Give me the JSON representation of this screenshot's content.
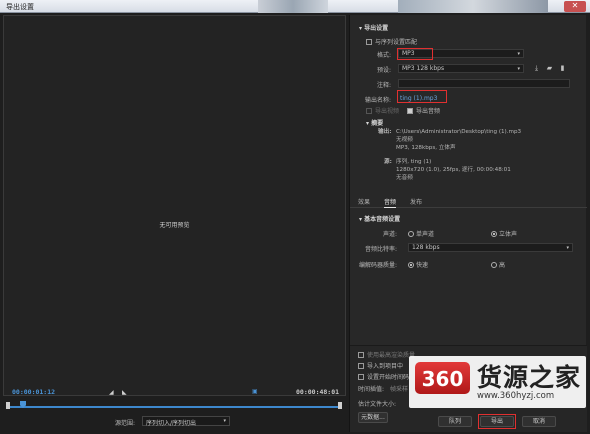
{
  "window": {
    "title": "导出设置",
    "close_glyph": "✕"
  },
  "preview": {
    "no_preview": "无可用预览",
    "timecode_in": "00:00:01:12",
    "timecode_out": "00:00:48:01",
    "source_range_label": "源范围:",
    "source_range_value": "序列切入/序列切出"
  },
  "export": {
    "section_title": "导出设置",
    "match_sequence_label": "与序列设置匹配",
    "format_label": "格式:",
    "format_value": "MP3",
    "preset_label": "预设:",
    "preset_value": "MP3 128 kbps",
    "comment_label": "注释:",
    "comment_value": "",
    "output_name_label": "输出名称:",
    "output_name_value": "ting (1).mp3",
    "export_video_label": "导出视频",
    "export_audio_label": "导出音频"
  },
  "summary": {
    "title": "摘要",
    "output_label": "输出:",
    "output_path": "C:\\Users\\Administrator\\Desktop\\ting (1).mp3",
    "output_line2": "无视频",
    "output_line3": "MP3, 128kbps, 立体声",
    "source_label": "源:",
    "source_line1": "序列, ting (1)",
    "source_line2": "1280x720 (1.0), 25fps, 逐行, 00:00:48:01",
    "source_line3": "无音频"
  },
  "tabs": [
    {
      "label": "效果",
      "active": false
    },
    {
      "label": "音频",
      "active": true
    },
    {
      "label": "发布",
      "active": false
    }
  ],
  "audio": {
    "basic_title": "基本音频设置",
    "channels_label": "声道:",
    "channel_mono": "单声道",
    "channel_stereo": "立体声",
    "bitrate_label": "音频比特率:",
    "bitrate_value": "128 kbps",
    "quality_label": "编解码器质量:",
    "quality_fast": "快速",
    "quality_high": "高"
  },
  "bottom": {
    "max_render_label": "使用最高渲染质量",
    "import_label": "导入到项目中",
    "set_start_label": "设置开始时间码",
    "time_interp_label": "时间插值:",
    "time_interp_value": "帧采样",
    "file_size_label": "估计文件大小:",
    "metadata_button": "元数据...",
    "queue_button": "队列",
    "export_button": "导出",
    "cancel_button": "取消"
  },
  "watermark": {
    "logo_text": "360",
    "brand": "货源之家",
    "url": "www.360hyzj.com"
  },
  "colors": {
    "accent_blue": "#4a93d6",
    "highlight_red": "#e03030",
    "panel_bg": "#282828"
  }
}
